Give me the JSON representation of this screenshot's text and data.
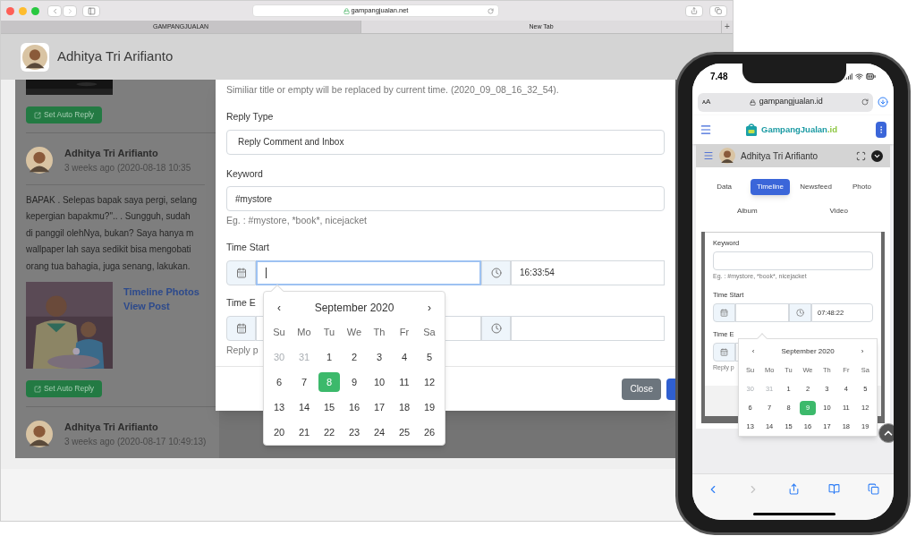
{
  "browser": {
    "url": "gampangjualan.net",
    "tabs": [
      {
        "label": "GAMPANGJUALAN",
        "selected": true
      },
      {
        "label": "New Tab",
        "selected": false
      }
    ],
    "new_tab": "+"
  },
  "header": {
    "user_name": "Adhitya Tri Arifianto"
  },
  "feed": {
    "top_button": "Set Auto Reply",
    "posts": [
      {
        "author": "Adhitya Tri Arifianto",
        "time": "3 weeks ago (2020-08-18 10:35",
        "text": "BAPAK . Selepas bapak saya pergi, selang\nkepergian bapakmu?\".. . Sungguh, sudah\ndi panggil olehNya, bukan? Saya hanya m\nwallpaper lah saya sedikit bisa mengobati\norang tua bahagia, juga senang, lakukan.",
        "links": [
          "Timeline Photos",
          "View Post"
        ],
        "button": "Set Auto Reply"
      },
      {
        "author": "Adhitya Tri Arifianto",
        "time": "3 weeks ago (2020-08-17 10:49:13)"
      }
    ]
  },
  "modal": {
    "note": "Similiar title or empty will be replaced by current time. (2020_09_08_16_32_54).",
    "reply_type": {
      "label": "Reply Type",
      "value": "Reply Comment and Inbox"
    },
    "keyword": {
      "label": "Keyword",
      "value": "#mystore",
      "hint": "Eg. : #mystore, *book*, nicejacket"
    },
    "time_start": {
      "label": "Time Start",
      "date_focused": true,
      "time": "16:33:54"
    },
    "time_end": {
      "label": "Time E",
      "hint": "Reply p"
    },
    "close_button": "Close"
  },
  "calendar": {
    "prev": "‹",
    "title": "September 2020",
    "next": "›",
    "weekdays": [
      "Su",
      "Mo",
      "Tu",
      "We",
      "Th",
      "Fr",
      "Sa"
    ],
    "weeks": [
      [
        {
          "day": "30",
          "muted": true,
          "selected": false
        },
        {
          "day": "31",
          "muted": true,
          "selected": false
        },
        {
          "day": "1",
          "muted": false,
          "selected": false
        },
        {
          "day": "2",
          "muted": false,
          "selected": false
        },
        {
          "day": "3",
          "muted": false,
          "selected": false
        },
        {
          "day": "4",
          "muted": false,
          "selected": false
        },
        {
          "day": "5",
          "muted": false,
          "selected": false
        }
      ],
      [
        {
          "day": "6",
          "muted": false,
          "selected": false
        },
        {
          "day": "7",
          "muted": false,
          "selected": false
        },
        {
          "day": "8",
          "muted": false,
          "selected": true
        },
        {
          "day": "9",
          "muted": false,
          "selected": false
        },
        {
          "day": "10",
          "muted": false,
          "selected": false
        },
        {
          "day": "11",
          "muted": false,
          "selected": false
        },
        {
          "day": "12",
          "muted": false,
          "selected": false
        }
      ],
      [
        {
          "day": "13",
          "muted": false,
          "selected": false
        },
        {
          "day": "14",
          "muted": false,
          "selected": false
        },
        {
          "day": "15",
          "muted": false,
          "selected": false
        },
        {
          "day": "16",
          "muted": false,
          "selected": false
        },
        {
          "day": "17",
          "muted": false,
          "selected": false
        },
        {
          "day": "18",
          "muted": false,
          "selected": false
        },
        {
          "day": "19",
          "muted": false,
          "selected": false
        }
      ],
      [
        {
          "day": "20",
          "muted": false,
          "selected": false
        },
        {
          "day": "21",
          "muted": false,
          "selected": false
        },
        {
          "day": "22",
          "muted": false,
          "selected": false
        },
        {
          "day": "23",
          "muted": false,
          "selected": false
        },
        {
          "day": "24",
          "muted": false,
          "selected": false
        },
        {
          "day": "25",
          "muted": false,
          "selected": false
        },
        {
          "day": "26",
          "muted": false,
          "selected": false
        }
      ]
    ]
  },
  "phone": {
    "clock": "7.48",
    "text_size": "ᴀA",
    "url": "gampangjualan.id",
    "brand": "GampangJualan",
    "brand_suffix": ".id",
    "user_name": "Adhitya Tri Arifianto",
    "tabs": [
      {
        "label": "Data",
        "selected": false
      },
      {
        "label": "Timeline",
        "selected": true
      },
      {
        "label": "Newsfeed",
        "selected": false
      },
      {
        "label": "Photo",
        "selected": false
      },
      {
        "label": "Album",
        "selected": false
      },
      {
        "label": "Video",
        "selected": false
      }
    ],
    "modal": {
      "keyword_label": "Keyword",
      "keyword_hint": "Eg. : #mystore, *book*, nicejacket",
      "time_start_label": "Time Start",
      "time": "07:48:22",
      "time_end_label": "Time E",
      "reply_hint": "Reply p"
    },
    "calendar": {
      "prev": "‹",
      "title": "September 2020",
      "next": "›",
      "weekdays": [
        "Su",
        "Mo",
        "Tu",
        "We",
        "Th",
        "Fr",
        "Sa"
      ],
      "weeks": [
        [
          {
            "day": "30",
            "muted": true,
            "selected": false
          },
          {
            "day": "31",
            "muted": true,
            "selected": false
          },
          {
            "day": "1",
            "muted": false,
            "selected": false
          },
          {
            "day": "2",
            "muted": false,
            "selected": false
          },
          {
            "day": "3",
            "muted": false,
            "selected": false
          },
          {
            "day": "4",
            "muted": false,
            "selected": false
          },
          {
            "day": "5",
            "muted": false,
            "selected": false
          }
        ],
        [
          {
            "day": "6",
            "muted": false,
            "selected": false
          },
          {
            "day": "7",
            "muted": false,
            "selected": false
          },
          {
            "day": "8",
            "muted": false,
            "selected": false
          },
          {
            "day": "9",
            "muted": false,
            "selected": true
          },
          {
            "day": "10",
            "muted": false,
            "selected": false
          },
          {
            "day": "11",
            "muted": false,
            "selected": false
          },
          {
            "day": "12",
            "muted": false,
            "selected": false
          }
        ],
        [
          {
            "day": "13",
            "muted": false,
            "selected": false
          },
          {
            "day": "14",
            "muted": false,
            "selected": false
          },
          {
            "day": "15",
            "muted": false,
            "selected": false
          },
          {
            "day": "16",
            "muted": false,
            "selected": false
          },
          {
            "day": "17",
            "muted": false,
            "selected": false
          },
          {
            "day": "18",
            "muted": false,
            "selected": false
          },
          {
            "day": "19",
            "muted": false,
            "selected": false
          }
        ]
      ]
    }
  }
}
